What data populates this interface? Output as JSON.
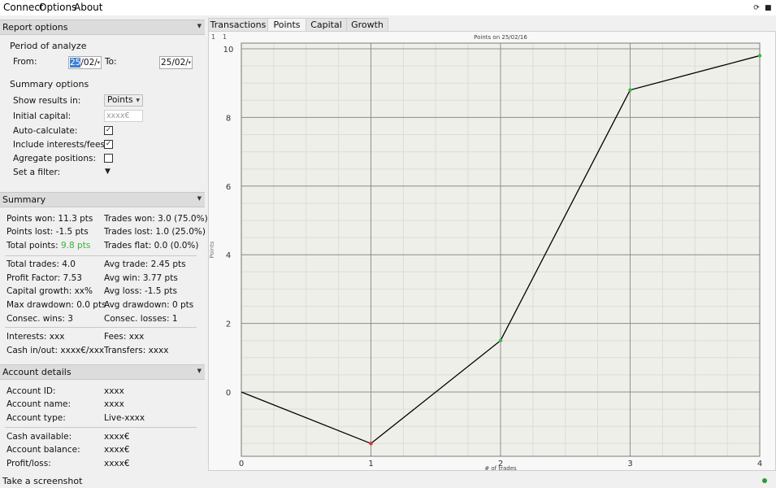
{
  "menu": {
    "connect": "Connect",
    "options": "Options",
    "about": "About"
  },
  "report_options": {
    "title": "Report options",
    "period_label": "Period of analyze",
    "from_label": "From:",
    "from_value_sel": "25",
    "from_value_rest": "/02/",
    "to_label": "To:",
    "to_value": "25/02/",
    "summary_options_label": "Summary options",
    "show_results_label": "Show results in:",
    "show_results_value": "Points",
    "initial_capital_label": "Initial capital:",
    "initial_capital_placeholder": "xxxx€",
    "auto_calculate_label": "Auto-calculate:",
    "auto_calculate_checked": true,
    "include_interests_label": "Include interests/fees:",
    "include_interests_checked": true,
    "aggregate_positions_label": "Agregate positions:",
    "aggregate_positions_checked": false,
    "set_filter_label": "Set a filter:"
  },
  "summary": {
    "title": "Summary",
    "points_won": "Points won: 11.3 pts",
    "trades_won": "Trades won: 3.0 (75.0%)",
    "points_lost": "Points lost: -1.5 pts",
    "trades_lost": "Trades lost: 1.0 (25.0%)",
    "total_points_label": "Total points:",
    "total_points_value": "9.8 pts",
    "total_points_color": "#3cb043",
    "trades_flat": "Trades flat: 0.0 (0.0%)",
    "total_trades": "Total trades: 4.0",
    "avg_trade": "Avg trade: 2.45 pts",
    "profit_factor": "Profit Factor: 7.53",
    "avg_win": "Avg win: 3.77 pts",
    "capital_growth": "Capital growth: xx%",
    "avg_loss": "Avg loss: -1.5 pts",
    "max_drawdown": "Max drawdown: 0.0 pts",
    "avg_drawdown": "Avg drawdown: 0 pts",
    "consec_wins": "Consec. wins: 3",
    "consec_losses": "Consec. losses: 1",
    "interests": "Interests: xxx",
    "fees": "Fees: xxx",
    "cash_in_out": "Cash in/out: xxxx€/xxx",
    "transfers": "Transfers: xxxx"
  },
  "account": {
    "title": "Account details",
    "id_label": "Account ID:",
    "id_value": "xxxx",
    "name_label": "Account name:",
    "name_value": "xxxx",
    "type_label": "Account type:",
    "type_value": "Live-xxxx",
    "cash_label": "Cash available:",
    "cash_value": "xxxx€",
    "balance_label": "Account balance:",
    "balance_value": "xxxx€",
    "pl_label": "Profit/loss:",
    "pl_value": "xxxx€"
  },
  "tabs": [
    "Transactions",
    "Points",
    "Capital",
    "Growth"
  ],
  "active_tab": "Points",
  "chart_data": {
    "type": "line",
    "title": "Points on 25/02/16",
    "xlabel": "# of trades",
    "ylabel": "Points",
    "x": [
      0,
      1,
      2,
      3,
      4
    ],
    "values": [
      0,
      -1.5,
      1.5,
      8.8,
      9.8
    ],
    "point_colors": [
      "none",
      "#e03030",
      "#2fbf3a",
      "#2fbf3a",
      "#2fbf3a"
    ],
    "xlim": [
      0,
      4
    ],
    "ylim": [
      -1.5,
      10
    ],
    "xticks": [
      "0",
      "1",
      "2",
      "3",
      "4"
    ],
    "yticks": [
      "0",
      "2",
      "4",
      "6",
      "8",
      "10"
    ],
    "x_minor_step": 0.25,
    "y_minor_step": 0.5,
    "grid": true,
    "corner_labels": [
      "1",
      "1"
    ]
  },
  "status": {
    "text": "Take a screenshot",
    "dot_color": "#2a9a3a"
  }
}
